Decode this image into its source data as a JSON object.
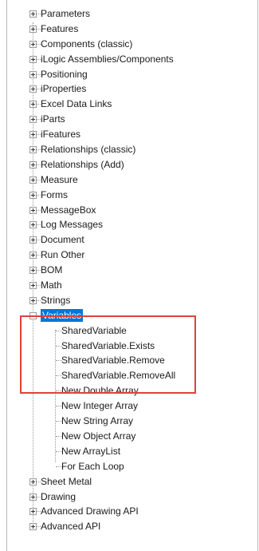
{
  "tree": {
    "items_before": [
      "Parameters",
      "Features",
      "Components (classic)",
      "iLogic Assemblies/Components",
      "Positioning",
      "iProperties",
      "Excel Data Links",
      "iParts",
      "iFeatures",
      "Relationships (classic)",
      "Relationships (Add)",
      "Measure",
      "Forms",
      "MessageBox",
      "Log Messages",
      "Document",
      "Run Other",
      "BOM",
      "Math",
      "Strings"
    ],
    "selected_item": "Variables",
    "variables_children": [
      "SharedVariable",
      "SharedVariable.Exists",
      "SharedVariable.Remove",
      "SharedVariable.RemoveAll",
      "New Double Array",
      "New Integer Array",
      "New String Array",
      "New Object Array",
      "New ArrayList",
      "For Each Loop"
    ],
    "items_after": [
      "Sheet Metal",
      "Drawing",
      "Advanced Drawing API",
      "Advanced API"
    ]
  },
  "colors": {
    "selection": "#0078d7",
    "highlight_border": "#e0413b"
  },
  "icons": {
    "expand": "plus-expander-icon",
    "collapse": "minus-expander-icon"
  }
}
